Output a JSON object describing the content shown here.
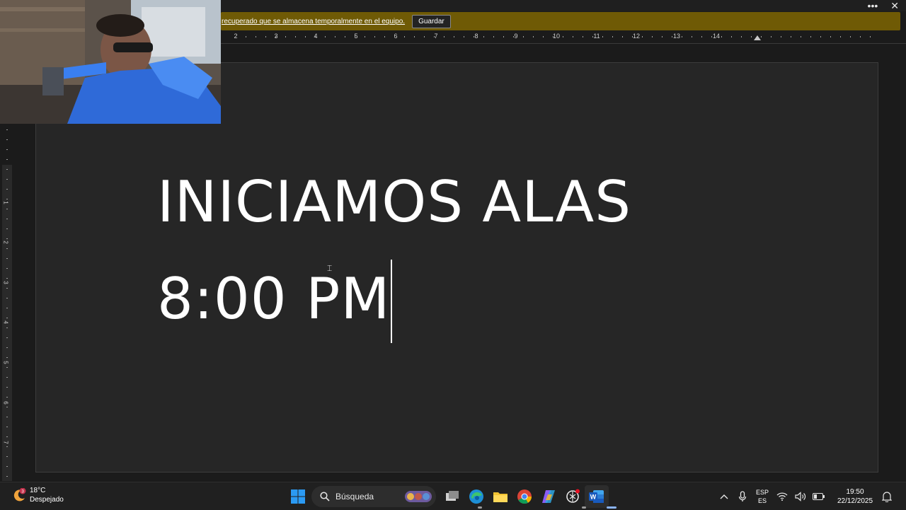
{
  "message_bar": {
    "text": "recuperado que se almacena temporalmente en el equipo.",
    "save_label": "Guardar"
  },
  "window_controls": {
    "more_label": "•••",
    "close_label": "✕"
  },
  "ruler": {
    "numbers": [
      "2",
      "3",
      "4",
      "5",
      "6",
      "7",
      "8",
      "9",
      "10",
      "11",
      "12",
      "13",
      "14"
    ],
    "vertical_numbers": [
      "1",
      "2",
      "3",
      "4",
      "5",
      "6",
      "7"
    ]
  },
  "document": {
    "line1": "INICIAMOS ALAS",
    "line2": "8:00 PM"
  },
  "taskbar": {
    "weather": {
      "temperature": "18°C",
      "condition": "Despejado",
      "badge": "3"
    },
    "search_placeholder": "Búsqueda",
    "apps": [
      "windows-start",
      "task-view",
      "edge",
      "file-explorer",
      "chrome",
      "copilot",
      "openai",
      "word"
    ],
    "language": {
      "line1": "ESP",
      "line2": "ES"
    },
    "clock": {
      "time": "19:50",
      "date": "22/12/2025"
    }
  },
  "colors": {
    "message_bar": "#6f5a05",
    "page": "#262626",
    "background": "#1b1b1b",
    "taskbar": "#202020",
    "word_blue": "#185abd"
  }
}
